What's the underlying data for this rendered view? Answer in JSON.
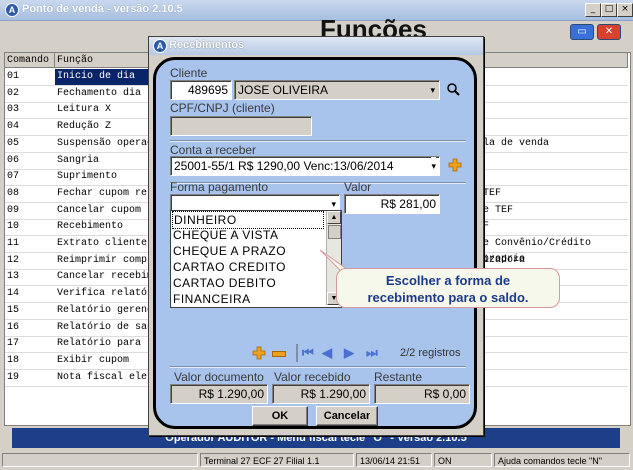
{
  "window": {
    "title": "Ponto de venda - versão 2.10.5",
    "heading": "Funções"
  },
  "grid": {
    "columns": [
      "Comando",
      "Função"
    ],
    "rows": [
      {
        "cmd": "01",
        "func": "Inicio de dia",
        "extra": ""
      },
      {
        "cmd": "02",
        "func": "Fechamento dia",
        "extra": ""
      },
      {
        "cmd": "03",
        "func": "Leitura X",
        "extra": ""
      },
      {
        "cmd": "04",
        "func": "Redução Z",
        "extra": ""
      },
      {
        "cmd": "05",
        "func": "Suspensão operaçõ",
        "extra": "la de venda"
      },
      {
        "cmd": "06",
        "func": "Sangria",
        "extra": ""
      },
      {
        "cmd": "07",
        "func": "Suprimento",
        "extra": ""
      },
      {
        "cmd": "08",
        "func": "Fechar cupom resu",
        "extra": " TEF"
      },
      {
        "cmd": "09",
        "func": "Cancelar cupom",
        "extra": "e TEF"
      },
      {
        "cmd": "10",
        "func": "Recebimento",
        "extra": "F"
      },
      {
        "cmd": "11",
        "func": "Extrato cliente",
        "extra": "e Convênio/Crédito proprio"
      },
      {
        "cmd": "12",
        "func": "Reimprimir compro",
        "extra": "izadora"
      },
      {
        "cmd": "13",
        "func": "Cancelar recebime",
        "extra": ""
      },
      {
        "cmd": "14",
        "func": "Verifica relatóri",
        "extra": ""
      },
      {
        "cmd": "15",
        "func": "Relatório gerenci",
        "extra": ""
      },
      {
        "cmd": "16",
        "func": "Relatório de sang",
        "extra": ""
      },
      {
        "cmd": "17",
        "func": "Relatório para tr",
        "extra": ""
      },
      {
        "cmd": "18",
        "func": "Exibir cupom",
        "extra": ""
      },
      {
        "cmd": "19",
        "func": "Nota fiscal eletr",
        "extra": ""
      }
    ]
  },
  "opbar": "Operador AUDITOR - Menu fiscal tecle \"O\" - Versão 2.10.5",
  "status": [
    "Terminal 27 ECF 27 Filial 1.1",
    "13/06/14 21:51",
    "ON",
    "Ajuda comandos tecle \"N\""
  ],
  "dialog": {
    "title": "Recebimentos",
    "cliente_label": "Cliente",
    "cliente_code": "489695",
    "cliente_name": "JOSE OLIVEIRA",
    "cpf_label": "CPF/CNPJ (cliente)",
    "cpf_value": "",
    "conta_label": "Conta a receber",
    "conta_value": "25001-55/1  R$ 1290,00 Venc:13/06/2014",
    "forma_label": "Forma pagamento",
    "forma_value": "",
    "valor_label": "Valor",
    "valor_value": "R$ 281,00",
    "forma_options": [
      "DINHEIRO",
      "CHEQUE A VISTA",
      "CHEQUE A PRAZO",
      "CARTAO CREDITO",
      "CARTAO DEBITO",
      "FINANCEIRA"
    ],
    "registros": "2/2 registros",
    "valor_documento_label": "Valor documento",
    "valor_documento": "R$ 1.290,00",
    "valor_recebido_label": "Valor recebido",
    "valor_recebido": "R$ 1.290,00",
    "restante_label": "Restante",
    "restante": "R$ 0,00",
    "ok_label": "OK",
    "cancel_label": "Cancelar"
  },
  "callout": [
    "Escolher a forma de",
    "recebimento para o saldo."
  ],
  "colors": {
    "accent": "#1d3f8a",
    "dialog_bg": "#a8c4ec",
    "plus_icon": "#f0a020",
    "nav_icon": "#4a6fd0"
  }
}
